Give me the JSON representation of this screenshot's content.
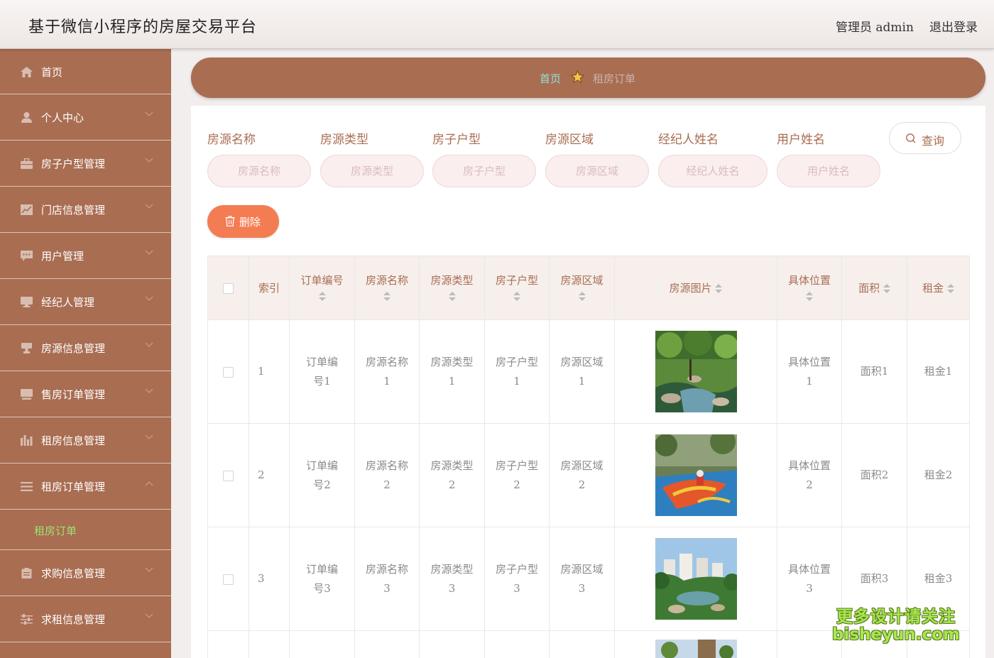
{
  "header": {
    "title": "基于微信小程序的房屋交易平台",
    "admin_label": "管理员 admin",
    "logout_label": "退出登录"
  },
  "sidebar": {
    "items": [
      {
        "label": "首页",
        "icon": "home-icon"
      },
      {
        "label": "个人中心",
        "icon": "user-icon"
      },
      {
        "label": "房子户型管理",
        "icon": "briefcase-icon"
      },
      {
        "label": "门店信息管理",
        "icon": "chart-icon"
      },
      {
        "label": "用户管理",
        "icon": "message-icon"
      },
      {
        "label": "经纪人管理",
        "icon": "monitor-icon"
      },
      {
        "label": "房源信息管理",
        "icon": "stamp-icon"
      },
      {
        "label": "售房订单管理",
        "icon": "screen-icon"
      },
      {
        "label": "租房信息管理",
        "icon": "bar-chart-icon"
      },
      {
        "label": "租房订单管理",
        "icon": "list-icon"
      },
      {
        "label": "求购信息管理",
        "icon": "clipboard-icon"
      },
      {
        "label": "求租信息管理",
        "icon": "sliders-icon"
      }
    ],
    "active_submenu": "租房订单"
  },
  "breadcrumb": {
    "home": "首页",
    "current": "租房订单"
  },
  "filters": [
    {
      "label": "房源名称",
      "placeholder": "房源名称"
    },
    {
      "label": "房源类型",
      "placeholder": "房源类型"
    },
    {
      "label": "房子户型",
      "placeholder": "房子户型"
    },
    {
      "label": "房源区域",
      "placeholder": "房源区域"
    },
    {
      "label": "经纪人姓名",
      "placeholder": "经纪人姓名"
    },
    {
      "label": "用户姓名",
      "placeholder": "用户姓名"
    }
  ],
  "buttons": {
    "search": "查询",
    "delete": "删除"
  },
  "table": {
    "columns": [
      "索引",
      "订单编号",
      "房源名称",
      "房源类型",
      "房子户型",
      "房源区域",
      "房源图片",
      "具体位置",
      "面积",
      "租金"
    ],
    "rows": [
      {
        "index": "1",
        "order_no": "订单编号1",
        "name": "房源名称1",
        "type": "房源类型1",
        "layout": "房子户型1",
        "region": "房源区域1",
        "image": "garden-pond",
        "location": "具体位置1",
        "area": "面积1",
        "rent": "租金1"
      },
      {
        "index": "2",
        "order_no": "订单编号2",
        "name": "房源名称2",
        "type": "房源类型2",
        "layout": "房子户型2",
        "region": "房源区域2",
        "image": "playground",
        "location": "具体位置2",
        "area": "面积2",
        "rent": "租金2"
      },
      {
        "index": "3",
        "order_no": "订单编号3",
        "name": "房源名称3",
        "type": "房源类型3",
        "layout": "房子户型3",
        "region": "房源区域3",
        "image": "residential-towers",
        "location": "具体位置3",
        "area": "面积3",
        "rent": "租金3"
      }
    ]
  },
  "watermark": {
    "line1": "更多设计请关注",
    "line2": "bisheyun.com"
  },
  "colors": {
    "sidebar": "#a96d52",
    "accent_text": "#a96d52",
    "delete_button": "#f47c53",
    "breadcrumb_home": "#8fe3d9",
    "submenu_active": "#9be36c"
  }
}
